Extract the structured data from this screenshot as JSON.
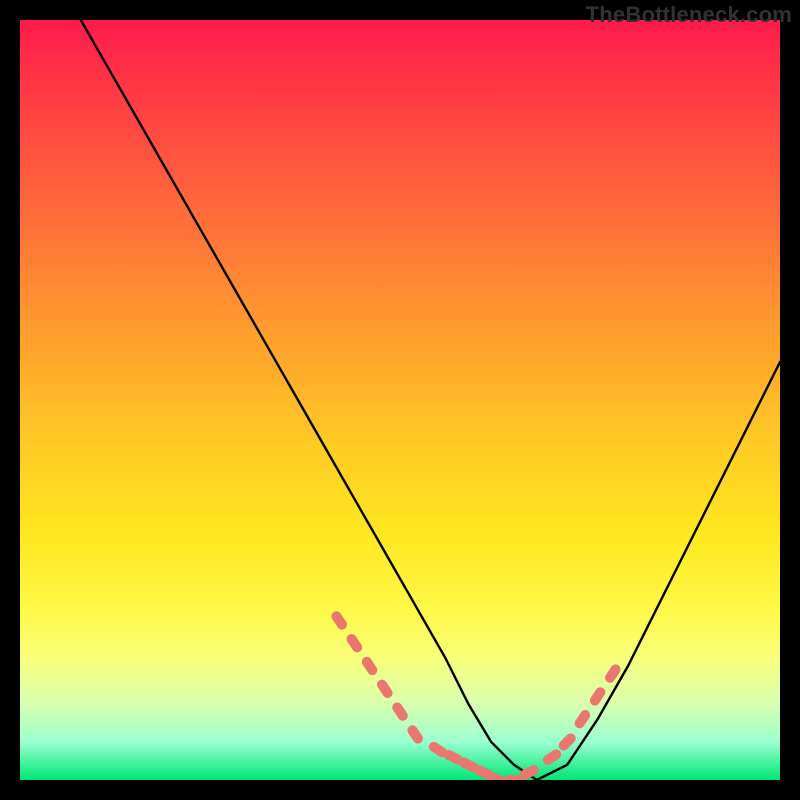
{
  "watermark": "TheBottleneck.com",
  "chart_data": {
    "type": "line",
    "title": "",
    "xlabel": "",
    "ylabel": "",
    "xlim": [
      0,
      100
    ],
    "ylim": [
      0,
      100
    ],
    "series": [
      {
        "name": "bottleneck-curve",
        "x": [
          8,
          12,
          16,
          20,
          24,
          28,
          32,
          36,
          40,
          44,
          48,
          52,
          56,
          59,
          62,
          65,
          68,
          72,
          76,
          80,
          84,
          88,
          92,
          96,
          100
        ],
        "values": [
          100,
          93,
          86,
          79,
          72,
          65,
          58,
          51,
          44,
          37,
          30,
          23,
          16,
          10,
          5,
          2,
          0,
          2,
          8,
          15,
          23,
          31,
          39,
          47,
          55
        ]
      }
    ],
    "markers": {
      "name": "highlight-points",
      "x": [
        42,
        44,
        46,
        48,
        50,
        52,
        55,
        57,
        59,
        61,
        63,
        65,
        67,
        70,
        72,
        74,
        76,
        78
      ],
      "values": [
        21,
        18,
        15,
        12,
        9,
        6,
        4,
        3,
        2,
        1,
        0,
        0,
        1,
        3,
        5,
        8,
        11,
        14
      ]
    },
    "grid": false,
    "legend": false,
    "background_gradient": {
      "top": "#ff1a4d",
      "bottom": "#00e676"
    }
  }
}
